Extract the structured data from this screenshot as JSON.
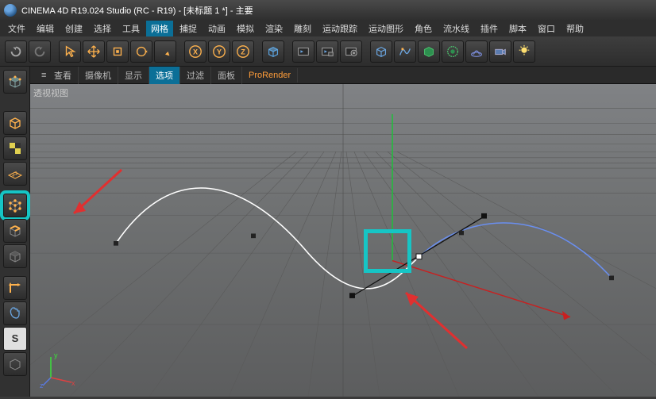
{
  "title": "CINEMA 4D R19.024 Studio (RC - R19) - [未标题 1 *] - 主要",
  "menu": [
    "文件",
    "编辑",
    "创建",
    "选择",
    "工具",
    "网格",
    "捕捉",
    "动画",
    "模拟",
    "渲染",
    "雕刻",
    "运动跟踪",
    "运动图形",
    "角色",
    "流水线",
    "插件",
    "脚本",
    "窗口",
    "帮助"
  ],
  "menu_active": "网格",
  "vp_tabs": [
    "查看",
    "摄像机",
    "显示",
    "选项",
    "过滤",
    "面板",
    "ProRender"
  ],
  "vp_tab_active": "选项",
  "vp_label": "透视视图",
  "axis": {
    "x": "x",
    "y": "y",
    "z": "z"
  }
}
